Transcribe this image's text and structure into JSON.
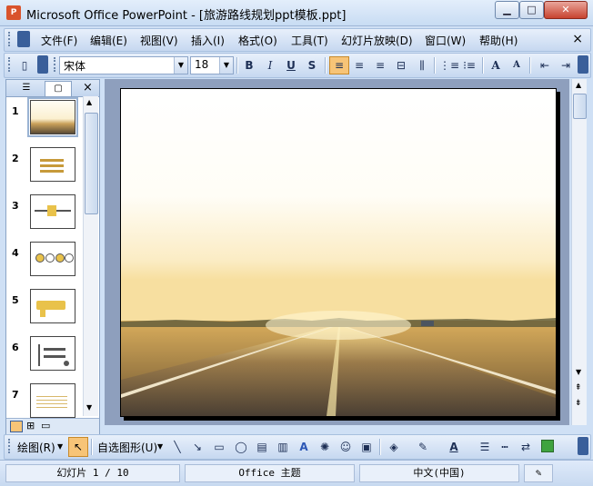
{
  "window": {
    "app_icon": "powerpoint-icon",
    "title": "Microsoft Office PowerPoint - [旅游路线规划ppt模板.ppt]",
    "controls": {
      "minimize": "▁",
      "maximize": "□",
      "close": "✕"
    }
  },
  "menu": {
    "items": [
      "文件(F)",
      "编辑(E)",
      "视图(V)",
      "插入(I)",
      "格式(O)",
      "工具(T)",
      "幻灯片放映(D)",
      "窗口(W)",
      "帮助(H)"
    ],
    "close": "×"
  },
  "toolbar": {
    "font_name": "宋体",
    "font_size": "18",
    "bold": "B",
    "italic": "I",
    "underline": "U",
    "shadow": "S",
    "grow_font": "A",
    "shrink_font": "A",
    "active_align": "align-left"
  },
  "left_pane": {
    "tabs": [
      "outline-tab-icon",
      "slides-tab-icon"
    ],
    "close": "×",
    "slides": [
      {
        "number": "1",
        "selected": true
      },
      {
        "number": "2",
        "selected": false
      },
      {
        "number": "3",
        "selected": false
      },
      {
        "number": "4",
        "selected": false
      },
      {
        "number": "5",
        "selected": false
      },
      {
        "number": "6",
        "selected": false
      },
      {
        "number": "7",
        "selected": false
      }
    ]
  },
  "drawing_toolbar": {
    "draw_label": "绘图(R)",
    "autoshapes_label": "自选图形(U)"
  },
  "status": {
    "slide": "幻灯片 1 / 10",
    "theme": "Office 主题",
    "language": "中文(中国)"
  },
  "colors": {
    "accent": "#f5c25a",
    "sky": "#fbf6e6",
    "road": "#5a4b36"
  }
}
